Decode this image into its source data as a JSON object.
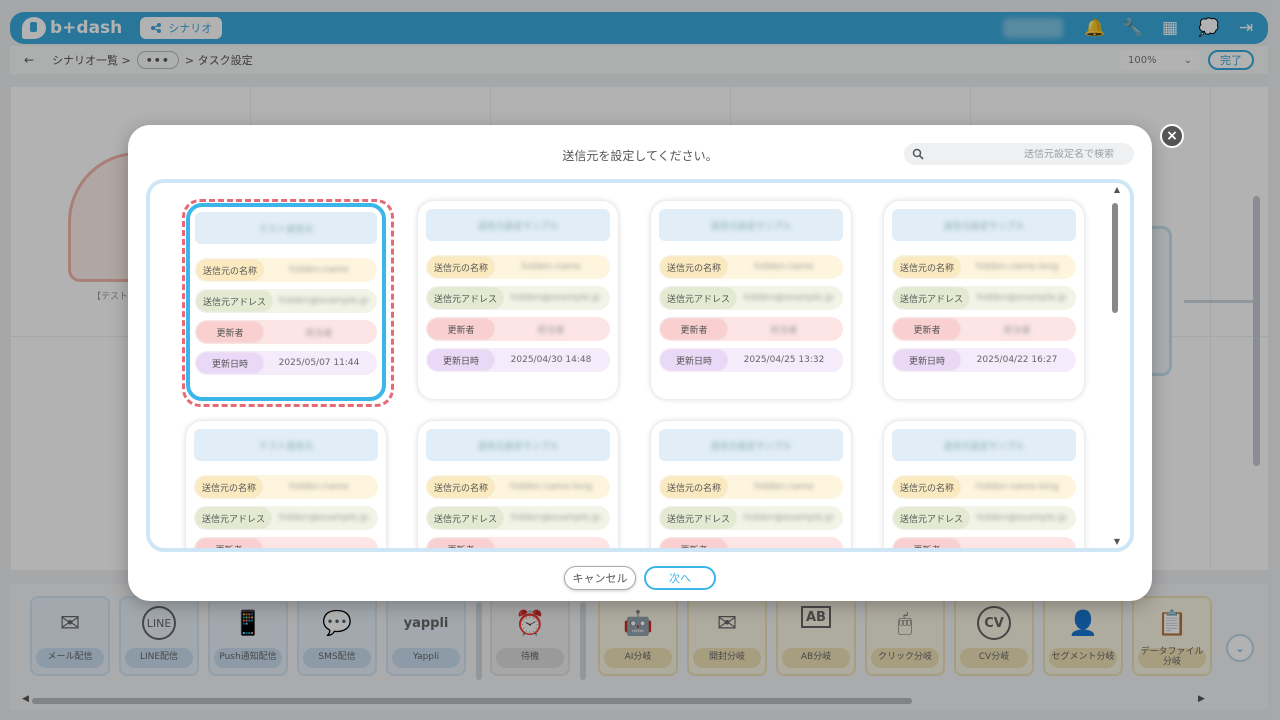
{
  "header": {
    "logo": "b+dash",
    "tab_label": "シナリオ"
  },
  "breadcrumb": {
    "parent": "シナリオ一覧",
    "more": "•••",
    "current": "タスク設定"
  },
  "toolbar": {
    "zoom": "100%",
    "done_label": "完了"
  },
  "canvas": {
    "node_label": "【テスト】"
  },
  "modal": {
    "title": "送信元を設定してください。",
    "search_placeholder": "送信元設定名で検索",
    "labels": {
      "name": "送信元の名称",
      "address": "送信元アドレス",
      "updater": "更新者",
      "updated_at": "更新日時"
    },
    "cards": [
      {
        "header": "テスト送信元",
        "name": "hidden-name",
        "address": "hidden@example.jp",
        "updater": "担当者",
        "updated_at": "2025/05/07 11:44"
      },
      {
        "header": "送信元設定サンプル",
        "name": "hidden-name",
        "address": "hidden@example.jp",
        "updater": "担当者",
        "updated_at": "2025/04/30 14:48"
      },
      {
        "header": "送信元設定サンプル",
        "name": "hidden-name",
        "address": "hidden@example.jp",
        "updater": "担当者",
        "updated_at": "2025/04/25 13:32"
      },
      {
        "header": "送信元設定サンプル",
        "name": "hidden-name-long",
        "address": "hidden@example.jp",
        "updater": "担当者",
        "updated_at": "2025/04/22 16:27"
      },
      {
        "header": "テスト送信元",
        "name": "hidden-name",
        "address": "hidden@example.jp"
      },
      {
        "header": "送信元設定サンプル",
        "name": "hidden-name-long",
        "address": "hidden@example.jp"
      },
      {
        "header": "送信元設定サンプル",
        "name": "hidden-name",
        "address": "hidden@example.jp"
      },
      {
        "header": "送信元設定サンプル",
        "name": "hidden-name-long",
        "address": "hidden@example.jp"
      }
    ],
    "cancel_label": "キャンセル",
    "next_label": "次へ"
  },
  "palette": {
    "tools": [
      {
        "label": "メール配信",
        "icon": "✉"
      },
      {
        "label": "LINE配信",
        "icon": "LINE"
      },
      {
        "label": "Push通知配信",
        "icon": "📱"
      },
      {
        "label": "SMS配信",
        "icon": "💬"
      },
      {
        "label": "Yappli",
        "icon": "yappli"
      },
      {
        "label": "待機",
        "icon": "⏰"
      },
      {
        "label": "AI分岐",
        "icon": "🤖"
      },
      {
        "label": "開封分岐",
        "icon": "✉"
      },
      {
        "label": "AB分岐",
        "icon": "AB"
      },
      {
        "label": "クリック分岐",
        "icon": "🖱"
      },
      {
        "label": "CV分岐",
        "icon": "CV"
      },
      {
        "label": "セグメント分岐",
        "icon": "👤"
      },
      {
        "label": "データファイル分岐",
        "icon": "📋"
      }
    ]
  }
}
